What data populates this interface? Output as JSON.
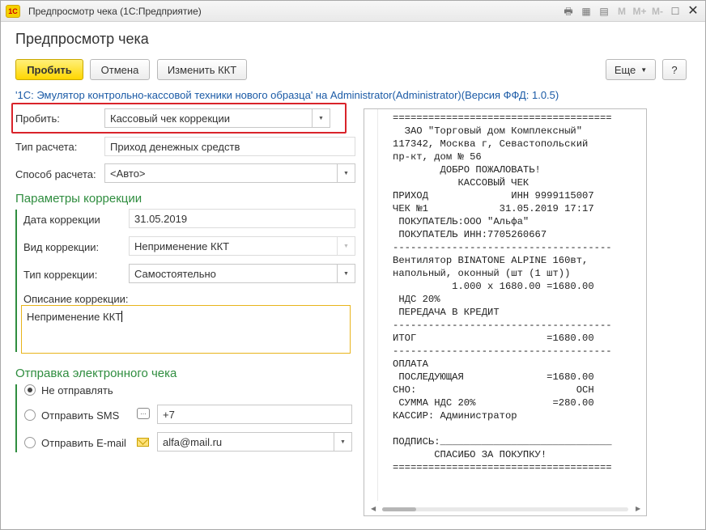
{
  "window": {
    "title": "Предпросмотр чека  (1С:Предприятие)",
    "logo": "1С",
    "title_buttons": [
      "M",
      "M+",
      "M-"
    ]
  },
  "page_title": "Предпросмотр чека",
  "toolbar": {
    "submit_label": "Пробить",
    "cancel_label": "Отмена",
    "change_kkt_label": "Изменить ККТ",
    "more_label": "Еще",
    "help_label": "?"
  },
  "kkt_info": "'1С: Эмулятор контрольно-кассовой техники нового образца' на Administrator(Administrator)(Версия ФФД: 1.0.5)",
  "form": {
    "check_type": {
      "label": "Пробить:",
      "value": "Кассовый чек коррекции"
    },
    "payment_kind": {
      "label": "Тип расчета:",
      "value": "Приход денежных средств"
    },
    "payment_method": {
      "label": "Способ расчета:",
      "value": "<Авто>"
    }
  },
  "correction": {
    "section_title": "Параметры коррекции",
    "date": {
      "label": "Дата коррекции",
      "value": "31.05.2019"
    },
    "kind": {
      "label": "Вид коррекции:",
      "value": "Неприменение ККТ"
    },
    "type": {
      "label": "Тип коррекции:",
      "value": "Самостоятельно"
    },
    "description": {
      "label": "Описание коррекции:",
      "value": "Неприменение ККТ"
    }
  },
  "e_receipt": {
    "section_title": "Отправка электронного чека",
    "options": [
      {
        "label": "Не отправлять",
        "checked": true
      },
      {
        "label": "Отправить SMS",
        "checked": false
      },
      {
        "label": "Отправить E-mail",
        "checked": false
      }
    ],
    "phone_value": "+7",
    "email_value": "alfa@mail.ru"
  },
  "receipt_lines": [
    "=====================================",
    "  ЗАО \"Торговый дом Комплексный\"",
    "117342, Москва г, Севастопольский",
    "пр-кт, дом № 56",
    "        ДОБРО ПОЖАЛОВАТЬ!",
    "           КАССОВЫЙ ЧЕК",
    "ПРИХОД              ИНН 9999115007",
    "ЧЕК №1            31.05.2019 17:17",
    " ПОКУПАТЕЛЬ:ООО \"Альфа\"",
    " ПОКУПАТЕЛЬ ИНН:7705260667",
    "-------------------------------------",
    "Вентилятор BINATONE ALPINE 160вт,",
    "напольный, оконный (шт (1 шт))",
    "          1.000 x 1680.00 =1680.00",
    " НДС 20%",
    " ПЕРЕДАЧА В КРЕДИТ",
    "-------------------------------------",
    "ИТОГ                      =1680.00",
    "-------------------------------------",
    "ОПЛАТА",
    " ПОСЛЕДУЮЩАЯ              =1680.00",
    "СНО:                           ОСН",
    " СУММА НДС 20%             =280.00",
    "КАССИР: Администратор",
    "",
    "ПОДПИСЬ:_____________________________",
    "       СПАСИБО ЗА ПОКУПКУ!",
    "====================================="
  ]
}
